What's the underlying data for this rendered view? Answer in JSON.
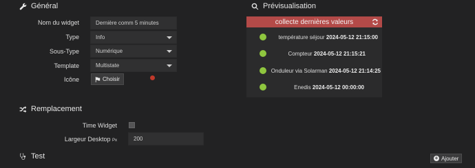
{
  "general": {
    "title": "Général",
    "fields": {
      "name_label": "Nom du widget",
      "name_value": "Dernière comm 5 minutes",
      "type_label": "Type",
      "type_value": "Info",
      "subtype_label": "Sous-Type",
      "subtype_value": "Numérique",
      "template_label": "Template",
      "template_value": "Multistate",
      "icon_label": "Icône",
      "choose_label": "Choisir"
    }
  },
  "preview": {
    "title": "Prévisualisation",
    "header": "collecte dernières valeurs",
    "rows": [
      {
        "label": "température séjour",
        "value": "2024-05-12 21:15:00"
      },
      {
        "label": "Compteur",
        "value": "2024-05-12 21:15:21"
      },
      {
        "label": "Onduleur via Solarman",
        "value": "2024-05-12 21:14:25"
      },
      {
        "label": "Enedis",
        "value": "2024-05-12 00:00:00"
      }
    ],
    "led_color": "#8fc63f"
  },
  "replacement": {
    "title": "Remplacement",
    "time_widget_label": "Time Widget",
    "desktop_width_label": "Largeur Desktop",
    "desktop_width_unit": "Px",
    "desktop_width_value": "200"
  },
  "test": {
    "title": "Test",
    "add_label": "Ajouter"
  },
  "colors": {
    "background": "#222223",
    "preview_header": "#b34a48",
    "status_red": "#c0392b"
  }
}
